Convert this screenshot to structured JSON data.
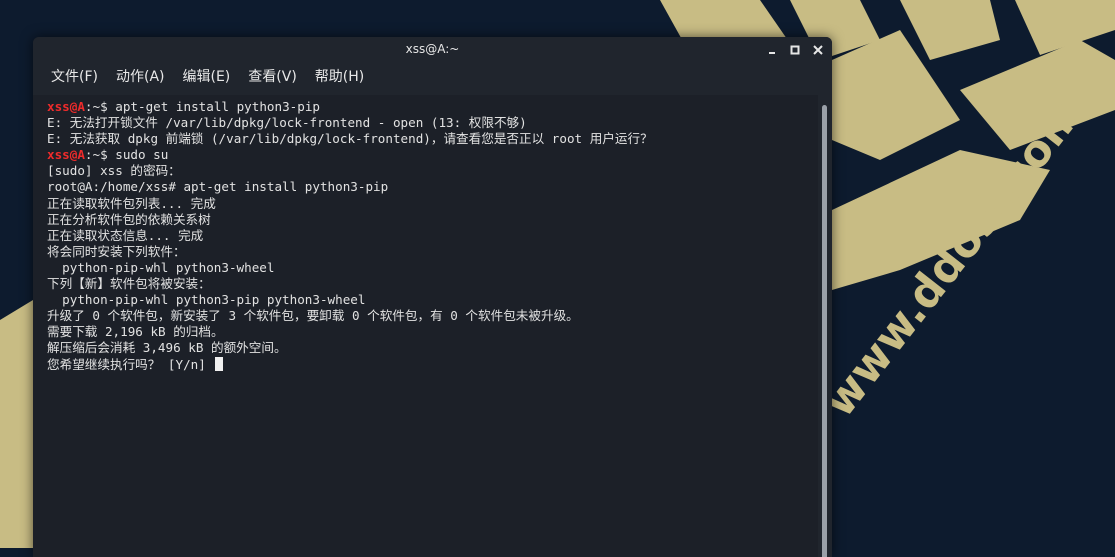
{
  "window": {
    "title": "xss@A:~"
  },
  "menu": [
    "文件(F)",
    "动作(A)",
    "编辑(E)",
    "查看(V)",
    "帮助(H)"
  ],
  "watermark": "www.ddosi.com",
  "terminal": {
    "lines": [
      {
        "user": "xss@A",
        "path": ":~$ ",
        "cmd": "apt-get install python3-pip"
      },
      {
        "text": "E: 无法打开锁文件 /var/lib/dpkg/lock-frontend - open (13: 权限不够)"
      },
      {
        "text": "E: 无法获取 dpkg 前端锁 (/var/lib/dpkg/lock-frontend)，请查看您是否正以 root 用户运行？"
      },
      {
        "user": "xss@A",
        "path": ":~$ ",
        "cmd": "sudo su"
      },
      {
        "text": "[sudo] xss 的密码："
      },
      {
        "text": "root@A:/home/xss# apt-get install python3-pip"
      },
      {
        "text": "正在读取软件包列表... 完成"
      },
      {
        "text": "正在分析软件包的依赖关系树"
      },
      {
        "text": "正在读取状态信息... 完成"
      },
      {
        "text": "将会同时安装下列软件："
      },
      {
        "text": "  python-pip-whl python3-wheel"
      },
      {
        "text": "下列【新】软件包将被安装："
      },
      {
        "text": "  python-pip-whl python3-pip python3-wheel"
      },
      {
        "text": "升级了 0 个软件包，新安装了 3 个软件包，要卸载 0 个软件包，有 0 个软件包未被升级。"
      },
      {
        "text": "需要下载 2,196 kB 的归档。"
      },
      {
        "text": "解压缩后会消耗 3,496 kB 的额外空间。"
      },
      {
        "text": "您希望继续执行吗？ [Y/n] ",
        "cursor": true
      }
    ]
  }
}
